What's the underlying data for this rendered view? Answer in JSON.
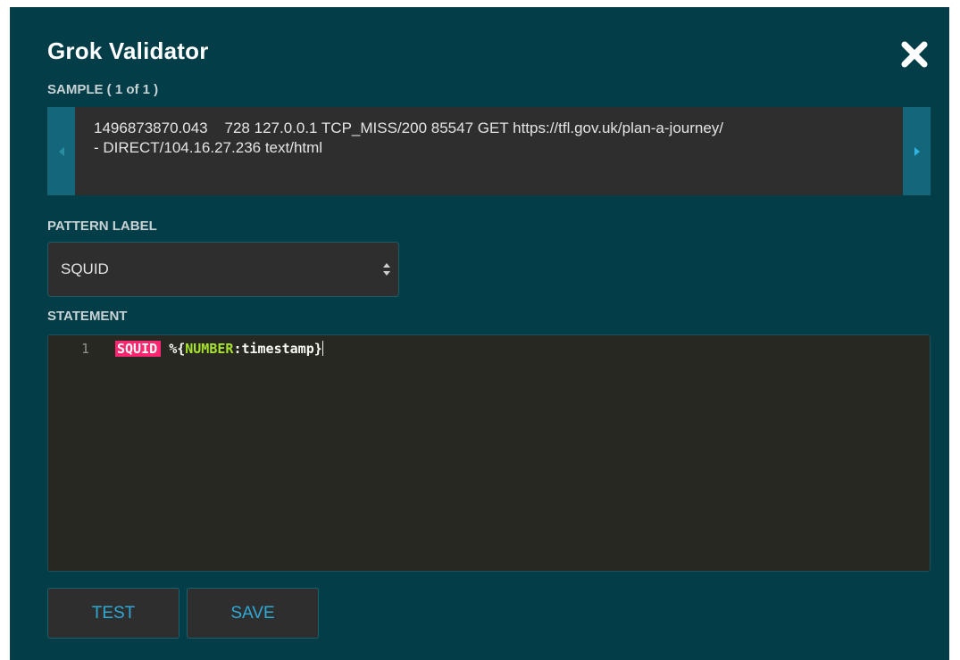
{
  "dialog": {
    "title": "Grok Validator",
    "close_icon": "close-icon"
  },
  "sample": {
    "label": "SAMPLE ( 1 of 1 )",
    "text_line1": "1496873870.043    728 127.0.0.1 TCP_MISS/200 85547 GET https://tfl.gov.uk/plan-a-journey/",
    "text_line2": "- DIRECT/104.16.27.236 text/html",
    "prev_icon": "chevron-left-icon",
    "next_icon": "chevron-right-icon"
  },
  "pattern": {
    "label": "PATTERN LABEL",
    "selected": "SQUID",
    "arrow_icon": "select-arrows-icon"
  },
  "statement": {
    "label": "STATEMENT",
    "line_number": "1",
    "tokens": {
      "keyword": "SQUID",
      "space": " ",
      "open": "%{",
      "type": "NUMBER",
      "close": ":timestamp}"
    }
  },
  "buttons": {
    "test_label": "TEST",
    "save_label": "SAVE"
  },
  "colors": {
    "dialog_bg": "#033d47",
    "sample_nav_bg": "#14677a",
    "panel_bg": "#2e2e2e",
    "editor_bg": "#272822",
    "keyword_highlight": "#f92672",
    "type_token": "#a6e22e",
    "button_text": "#2fa9d6"
  }
}
